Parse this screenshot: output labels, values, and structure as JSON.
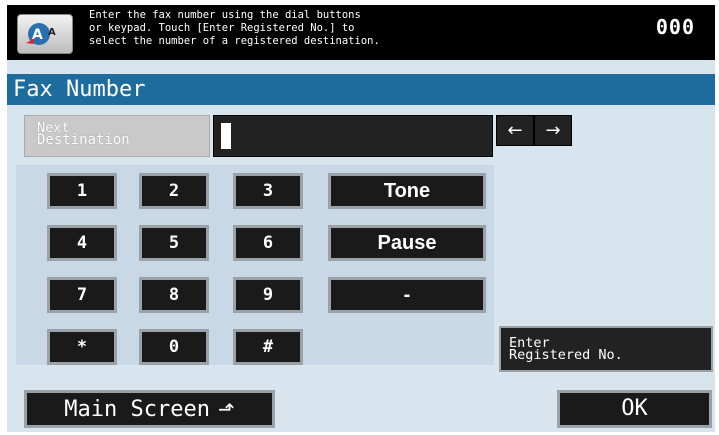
{
  "header": {
    "instruction_lines": [
      "Enter the fax number using the dial buttons",
      "or keypad. Touch [Enter Registered No.] to",
      "select the number of a registered destination."
    ],
    "counter": "000",
    "mode_icon": "accessibility-aa-icon"
  },
  "title": "Fax Number",
  "next_destination": {
    "line1": "Next",
    "line2": "Destination"
  },
  "fax_field": {
    "value": ""
  },
  "arrows": {
    "left": "←",
    "right": "→"
  },
  "keypad": {
    "keys": [
      "1",
      "2",
      "3",
      "4",
      "5",
      "6",
      "7",
      "8",
      "9",
      "*",
      "0",
      "#"
    ],
    "tone": "Tone",
    "pause": "Pause",
    "dash": "-"
  },
  "enter_registered": {
    "line1": "Enter",
    "line2": "Registered No."
  },
  "footer": {
    "main_screen": "Main Screen",
    "main_screen_icon": "up-arrow-icon",
    "ok": "OK"
  }
}
